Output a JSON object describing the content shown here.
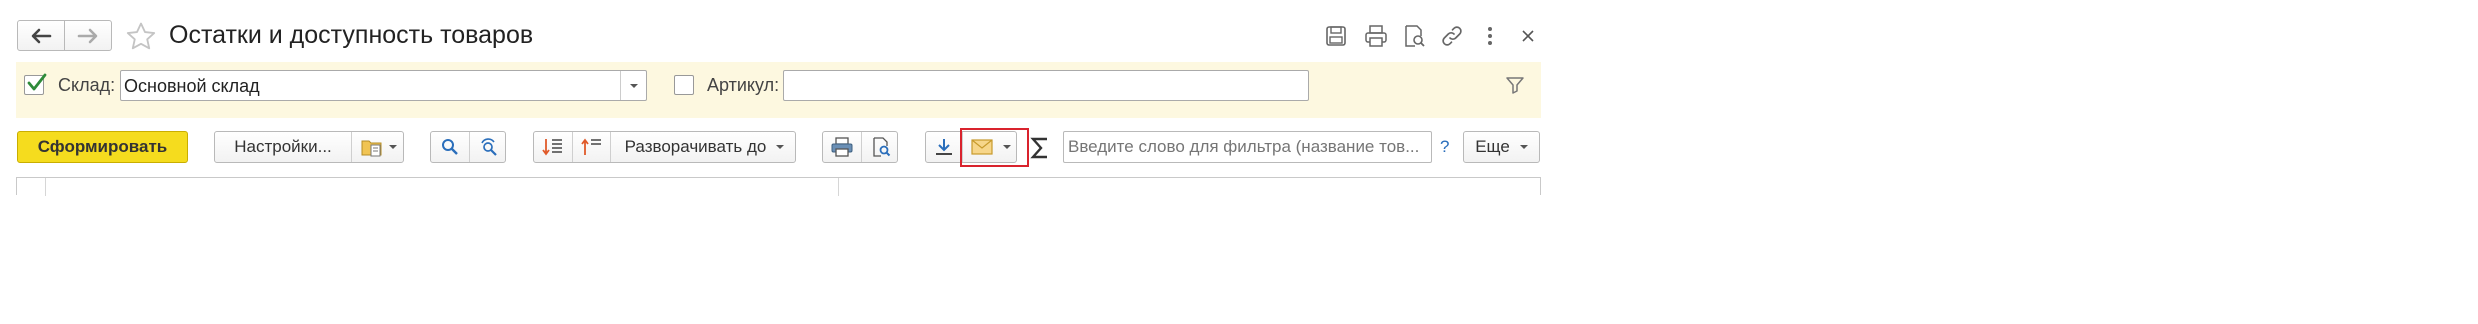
{
  "window": {
    "title": "Остатки и доступность товаров"
  },
  "filters": {
    "warehouse_label": "Склад:",
    "warehouse_value": "Основной склад",
    "warehouse_checked": true,
    "article_label": "Артикул:",
    "article_value": "",
    "article_checked": false
  },
  "toolbar": {
    "generate_label": "Сформировать",
    "settings_label": "Настройки...",
    "expand_label": "Разворачивать до",
    "search_placeholder": "Введите слово для фильтра (название тов...",
    "help_label": "?",
    "more_label": "Еще"
  },
  "colors": {
    "filter_bg": "#fdf8e0",
    "primary_button": "#f5dc1e",
    "highlight_border": "#d9232d",
    "check_green": "#2e8b3a",
    "link_blue": "#2a6ebb"
  }
}
